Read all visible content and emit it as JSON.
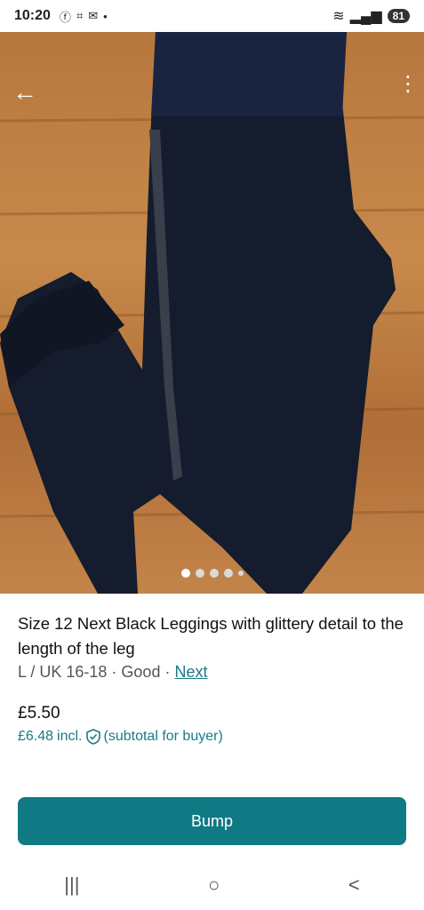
{
  "status_bar": {
    "time": "10:20",
    "battery": "81",
    "left_icons": [
      "facebook-icon",
      "screenshot-icon",
      "mail-icon",
      "dot-icon"
    ],
    "right_icons": [
      "wifi-icon",
      "signal-icon"
    ]
  },
  "gallery": {
    "image_count": 5,
    "active_index": 0
  },
  "item": {
    "title": "Size 12 Next Black Leggings with glittery detail to the length of the leg",
    "size": "L / UK 16-18",
    "separator": "·",
    "condition": "Good",
    "brand": "Next",
    "price": "£5.50",
    "price_incl": "£6.48",
    "incl_label": "incl.",
    "incl_note": "(subtotal for buyer)"
  },
  "actions": {
    "bump_label": "Bump"
  },
  "system_nav": {
    "recents": "|||",
    "home": "○",
    "back": "<"
  },
  "colors": {
    "accent": "#0f7a83",
    "link": "#1a7a85"
  }
}
